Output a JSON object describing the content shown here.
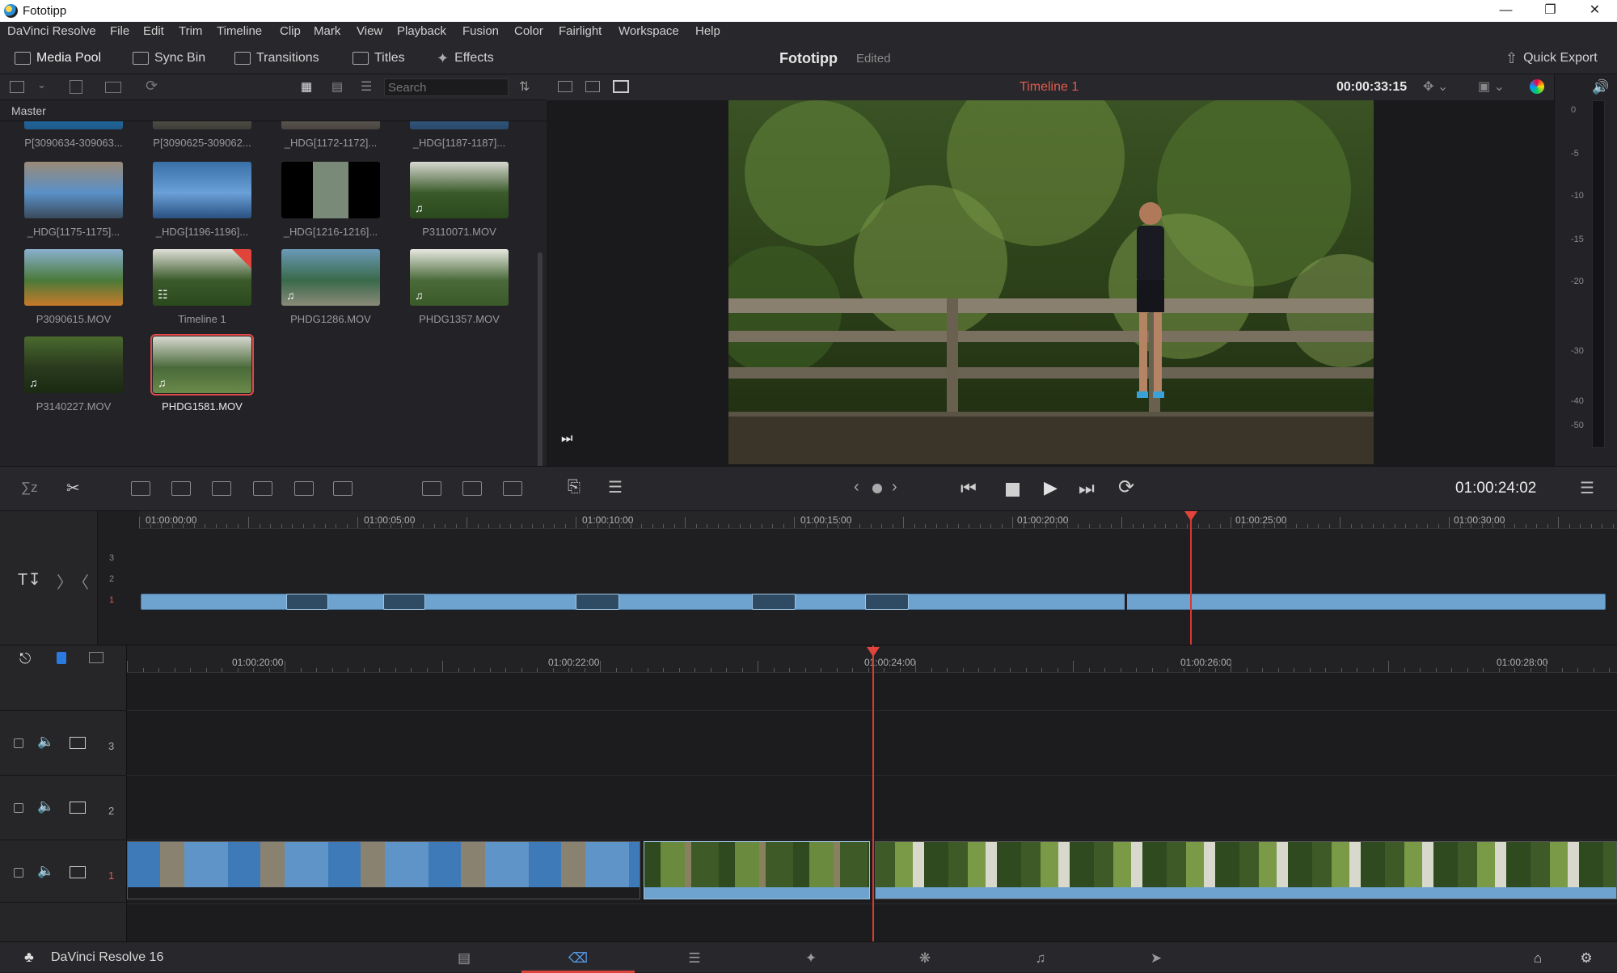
{
  "window": {
    "title": "Fototipp"
  },
  "menu": [
    "DaVinci Resolve",
    "File",
    "Edit",
    "Trim",
    "Timeline",
    "Clip",
    "Mark",
    "View",
    "Playback",
    "Fusion",
    "Color",
    "Fairlight",
    "Workspace",
    "Help"
  ],
  "toolbar": {
    "media_pool": "Media Pool",
    "sync_bin": "Sync Bin",
    "transitions": "Transitions",
    "titles": "Titles",
    "effects": "Effects",
    "project_title": "Fototipp",
    "project_status": "Edited",
    "quick_export": "Quick Export"
  },
  "media_pool": {
    "search_placeholder": "Search",
    "bin": "Master",
    "clips": [
      {
        "name": "P[3090634-309063...",
        "colors": [
          "#2a7ab8",
          "#4aa0d0",
          "#1e5a8a"
        ]
      },
      {
        "name": "P[3090625-309062...",
        "colors": [
          "#6a6a60",
          "#8a8478",
          "#3e3e38"
        ]
      },
      {
        "name": "_HDG[1172-1172]...",
        "colors": [
          "#7a7470",
          "#aaa49a",
          "#4a4440"
        ]
      },
      {
        "name": "_HDG[1187-1187]...",
        "colors": [
          "#3a6a9a",
          "#5a8ab8",
          "#2a4a6a"
        ]
      },
      {
        "name": "_HDG[1175-1175]...",
        "colors": [
          "#5a90c8",
          "#9a8a78",
          "#3a4a5a"
        ]
      },
      {
        "name": "_HDG[1196-1196]...",
        "colors": [
          "#6aa0d8",
          "#3a70a8",
          "#2a5080"
        ]
      },
      {
        "name": "_HDG[1216-1216]...",
        "colors": [
          "#000000",
          "#7a8a78",
          "#000000"
        ]
      },
      {
        "name": "P3110071.MOV",
        "colors": [
          "#3a5a2a",
          "#d8d8d0",
          "#2a4a1e"
        ]
      },
      {
        "name": "P3090615.MOV",
        "colors": [
          "#4a7a3a",
          "#8ab0d0",
          "#c87a2a"
        ]
      },
      {
        "name": "Timeline 1",
        "colors": [
          "#3a5a2a",
          "#e0e0d8",
          "#2a4a1e"
        ]
      },
      {
        "name": "PHDG1286.MOV",
        "colors": [
          "#3a6a4a",
          "#6a9ab8",
          "#8a8a78"
        ]
      },
      {
        "name": "PHDG1357.MOV",
        "colors": [
          "#4a6a3a",
          "#e8e8e0",
          "#3a5a2a"
        ]
      },
      {
        "name": "P3140227.MOV",
        "colors": [
          "#2a3a1e",
          "#4a6a2e",
          "#1a2a12"
        ]
      },
      {
        "name": "PHDG1581.MOV",
        "colors": [
          "#4a6a3a",
          "#d8d8d0",
          "#6a8a4a"
        ]
      }
    ]
  },
  "viewer": {
    "timeline_name": "Timeline 1",
    "source_timecode": "00:00:33:15",
    "record_timecode": "01:00:24:02"
  },
  "meter_labels": [
    "0",
    "-5",
    "-10",
    "-15",
    "-20",
    "-30",
    "-40",
    "-50"
  ],
  "upper_ruler": [
    "01:00:00:00",
    "01:00:05:00",
    "01:00:10:00",
    "01:00:15:00",
    "01:00:20:00",
    "01:00:25:00",
    "01:00:30:00"
  ],
  "lower_ruler": [
    "01:00:20:00",
    "01:00:22:00",
    "01:00:24:00",
    "01:00:26:00",
    "01:00:28:00"
  ],
  "tracks": [
    "3",
    "2",
    "1"
  ],
  "mini_tracks": [
    "3",
    "2",
    "1"
  ],
  "pagebar": {
    "app_name": "DaVinci Resolve 16"
  },
  "accent": "#e0443a"
}
